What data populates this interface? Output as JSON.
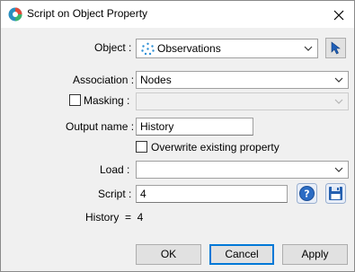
{
  "window": {
    "title": "Script on Object Property",
    "close_icon": "close-icon",
    "app_icon": "app-icon"
  },
  "object": {
    "label": "Object :",
    "value": "Observations",
    "icon": "scatter-points-icon"
  },
  "association": {
    "label": "Association :",
    "value": "Nodes"
  },
  "masking": {
    "label": "Masking :",
    "checked": false,
    "value": ""
  },
  "output_name": {
    "label": "Output name :",
    "value": "History"
  },
  "overwrite": {
    "label": "Overwrite existing property",
    "checked": false
  },
  "load": {
    "label": "Load :",
    "value": ""
  },
  "script": {
    "label": "Script :",
    "value": "4"
  },
  "result": {
    "text": "History  =  4"
  },
  "buttons": {
    "ok": "OK",
    "cancel": "Cancel",
    "apply": "Apply"
  },
  "colors": {
    "accent": "#0078d7",
    "help_blue": "#2b6cc4",
    "background": "#f0f0f0"
  }
}
